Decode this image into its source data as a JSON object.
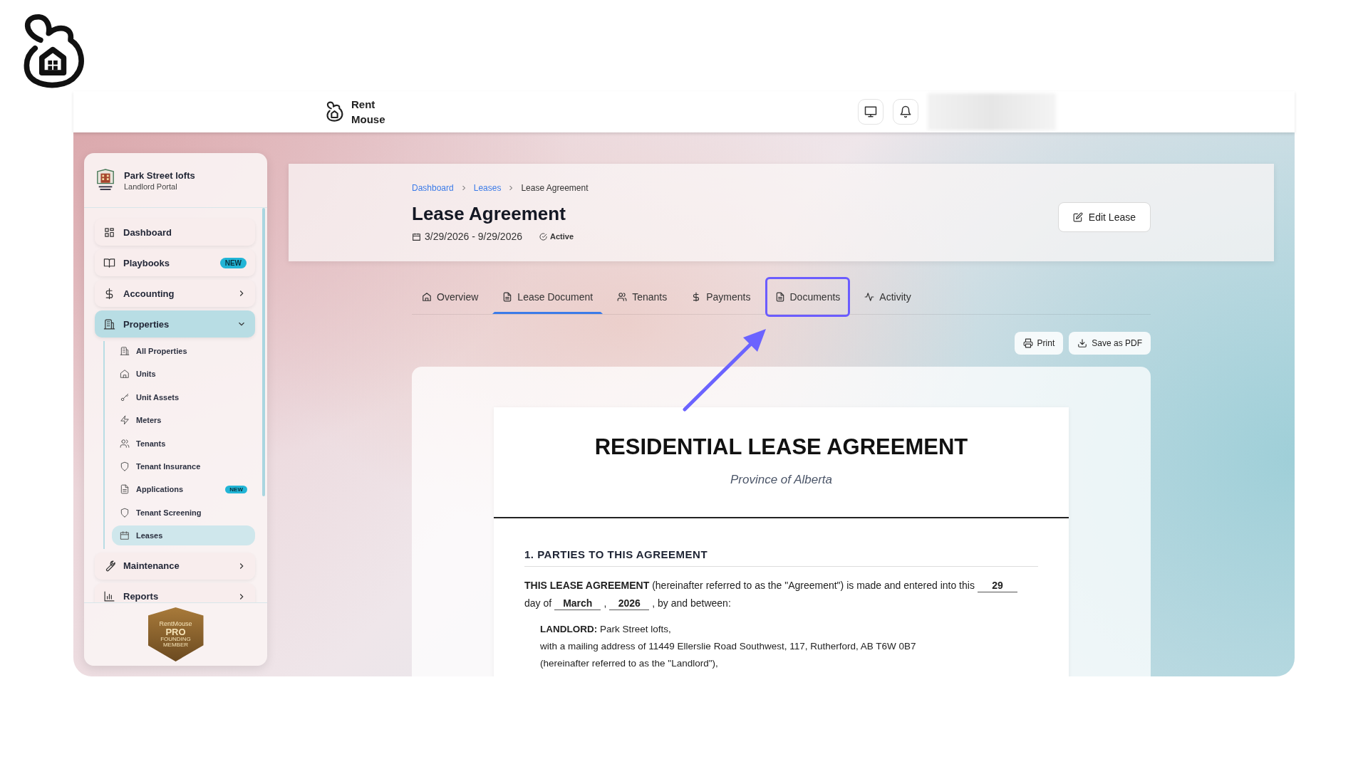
{
  "top_bar": {
    "brand": "Rent Mouse"
  },
  "sidebar": {
    "org_name": "Park Street lofts",
    "org_subtitle": "Landlord Portal",
    "items": [
      {
        "label": "Dashboard",
        "selected": false
      },
      {
        "label": "Playbooks",
        "badge": "NEW",
        "selected": false
      },
      {
        "label": "Accounting",
        "expanded": false,
        "selected": false
      },
      {
        "label": "Properties",
        "expanded": true,
        "selected": true,
        "children": [
          {
            "label": "All Properties",
            "selected": false
          },
          {
            "label": "Units",
            "selected": false
          },
          {
            "label": "Unit Assets",
            "selected": false
          },
          {
            "label": "Meters",
            "selected": false
          },
          {
            "label": "Tenants",
            "selected": false
          },
          {
            "label": "Tenant Insurance",
            "selected": false
          },
          {
            "label": "Applications",
            "badge": "NEW",
            "selected": false
          },
          {
            "label": "Tenant Screening",
            "selected": false
          },
          {
            "label": "Leases",
            "selected": true
          }
        ]
      },
      {
        "label": "Maintenance",
        "expanded": false,
        "selected": false
      },
      {
        "label": "Reports",
        "expanded": false,
        "selected": false
      }
    ],
    "emblem": {
      "brand": "RentMouse",
      "tier": "PRO",
      "lines": [
        "FOUNDING",
        "MEMBER"
      ]
    }
  },
  "header": {
    "breadcrumbs": [
      {
        "label": "Dashboard",
        "link": true
      },
      {
        "label": "Leases",
        "link": true
      },
      {
        "label": "Lease Agreement",
        "link": false
      }
    ],
    "title": "Lease Agreement",
    "dates": "3/29/2026 - 9/29/2026",
    "status": "Active",
    "edit_button": "Edit Lease"
  },
  "tabs": [
    {
      "label": "Overview",
      "selected": false,
      "highlighted": false
    },
    {
      "label": "Lease Document",
      "selected": true,
      "highlighted": false
    },
    {
      "label": "Tenants",
      "selected": false,
      "highlighted": false
    },
    {
      "label": "Payments",
      "selected": false,
      "highlighted": false
    },
    {
      "label": "Documents",
      "selected": false,
      "highlighted": true
    },
    {
      "label": "Activity",
      "selected": false,
      "highlighted": false
    }
  ],
  "actions": [
    "Print",
    "Save as PDF"
  ],
  "document": {
    "title": "RESIDENTIAL LEASE AGREEMENT",
    "subtitle": "Province of Alberta",
    "section": "1. PARTIES TO THIS AGREEMENT",
    "paragraph": [
      {
        "kind": "text",
        "text": "**THIS LEASE AGREEMENT** (hereinafter referred to as the \"Agreement\") is made and entered into this"
      },
      {
        "kind": "blank",
        "text": "29"
      },
      {
        "kind": "text",
        "text": "day of"
      },
      {
        "kind": "blank",
        "text": "March"
      },
      {
        "kind": "text",
        "text": ","
      },
      {
        "kind": "blank",
        "text": "2026"
      },
      {
        "kind": "text",
        "text": ", by and between:"
      }
    ],
    "landlord_lines": [
      "**LANDLORD:** Park Street lofts,",
      "with a mailing address of 11449 Ellerslie Road Southwest, 117, Rutherford, AB T6W 0B7",
      "(hereinafter referred to as the \"Landlord\"),"
    ]
  }
}
